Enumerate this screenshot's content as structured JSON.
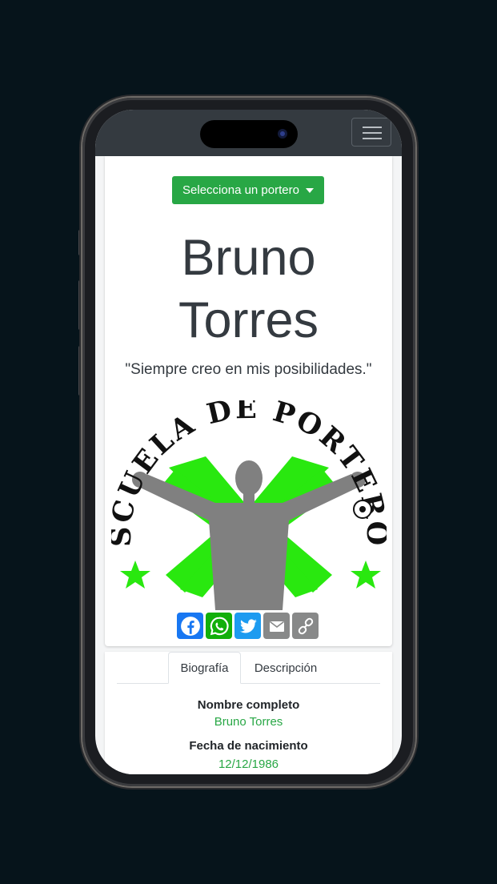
{
  "header": {
    "menu_icon": "hamburger-menu-icon"
  },
  "selector": {
    "label": "Selecciona un portero"
  },
  "player": {
    "name_line1": "Bruno",
    "name_line2": "Torres",
    "quote": "\"Siempre creo en mis posibilidades.\""
  },
  "logo": {
    "text": "ESCUELA DE PORTEROS",
    "brand_green": "#29e80f",
    "silhouette": "#808080"
  },
  "share": {
    "items": [
      {
        "name": "facebook-icon",
        "color": "#1877f2"
      },
      {
        "name": "whatsapp-icon",
        "color": "#12af0a"
      },
      {
        "name": "twitter-icon",
        "color": "#1d9bf0"
      },
      {
        "name": "email-icon",
        "color": "#888989"
      },
      {
        "name": "copy-link-icon",
        "color": "#888989"
      }
    ]
  },
  "tabs": [
    {
      "label": "Biografía",
      "active": true
    },
    {
      "label": "Descripción",
      "active": false
    }
  ],
  "bio": {
    "full_name_label": "Nombre completo",
    "full_name_value": "Bruno Torres",
    "birth_label": "Fecha de nacimiento",
    "birth_value": "12/12/1986"
  },
  "colors": {
    "accent": "#28a745",
    "navbar": "#343a40",
    "background": "#06141b"
  }
}
